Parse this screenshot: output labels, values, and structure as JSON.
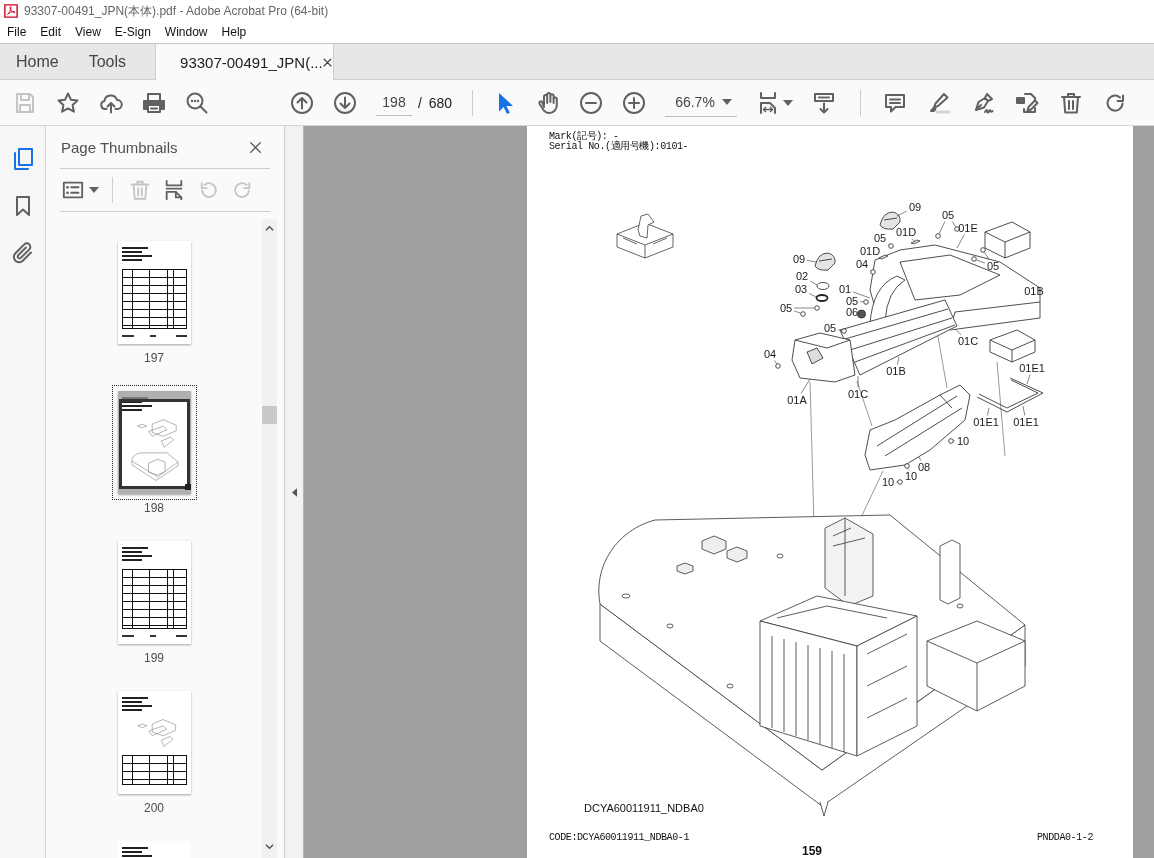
{
  "window": {
    "title": "93307-00491_JPN(本体).pdf - Adobe Acrobat Pro (64-bit)"
  },
  "menu": [
    "File",
    "Edit",
    "View",
    "E-Sign",
    "Window",
    "Help"
  ],
  "tabs": [
    {
      "label": "Home",
      "kind": "nav",
      "selected": false
    },
    {
      "label": "Tools",
      "kind": "nav",
      "selected": false
    },
    {
      "label": "93307-00491_JPN(...",
      "kind": "document",
      "selected": true
    }
  ],
  "toolbar": {
    "file_tools": [
      {
        "disabled": true
      },
      {
        "disabled": false
      },
      {
        "disabled": false
      },
      {
        "disabled": false
      },
      {
        "disabled": false
      }
    ],
    "page": "198",
    "page_count": "/ 680",
    "pointer_tools": [
      {
        "selected": true
      },
      {
        "selected": false
      }
    ],
    "zoom": "66.7%"
  },
  "side_rail": [
    {
      "selected": true
    },
    {
      "selected": false
    },
    {
      "selected": false
    }
  ],
  "sidebar": {
    "title": "Page Thumbnails",
    "tools": [
      {
        "disabled": false
      },
      {
        "disabled": true
      },
      {
        "disabled": false
      },
      {
        "disabled": true
      },
      {
        "disabled": true
      }
    ],
    "thumbnails": [
      {
        "label": "197",
        "kind": "table",
        "selected": false
      },
      {
        "label": "198",
        "kind": "drawing",
        "selected": true
      },
      {
        "label": "199",
        "kind": "table",
        "selected": false
      },
      {
        "label": "200",
        "kind": "mixed",
        "selected": false
      },
      {
        "kind": "table",
        "selected": false
      }
    ]
  },
  "document": {
    "header": [
      "Mark(記号): -",
      "Serial No.(適用号機):0101-"
    ],
    "callouts": [
      "09",
      "05",
      "05",
      "01D",
      "01E",
      "09",
      "01D",
      "04",
      "05",
      "02",
      "03",
      "01",
      "01B",
      "05",
      "05",
      "06",
      "05",
      "01C",
      "04",
      "01B",
      "01E1",
      "01A",
      "01C",
      "01E1",
      "01E1",
      "10",
      "10",
      "10",
      "08"
    ],
    "drawing_code": "DCYA60011911_NDBA0",
    "code": "CODE:DCYA60011911_NDBA0-1",
    "page_number": "159",
    "page_ref": "PNDDA0-1-2"
  }
}
